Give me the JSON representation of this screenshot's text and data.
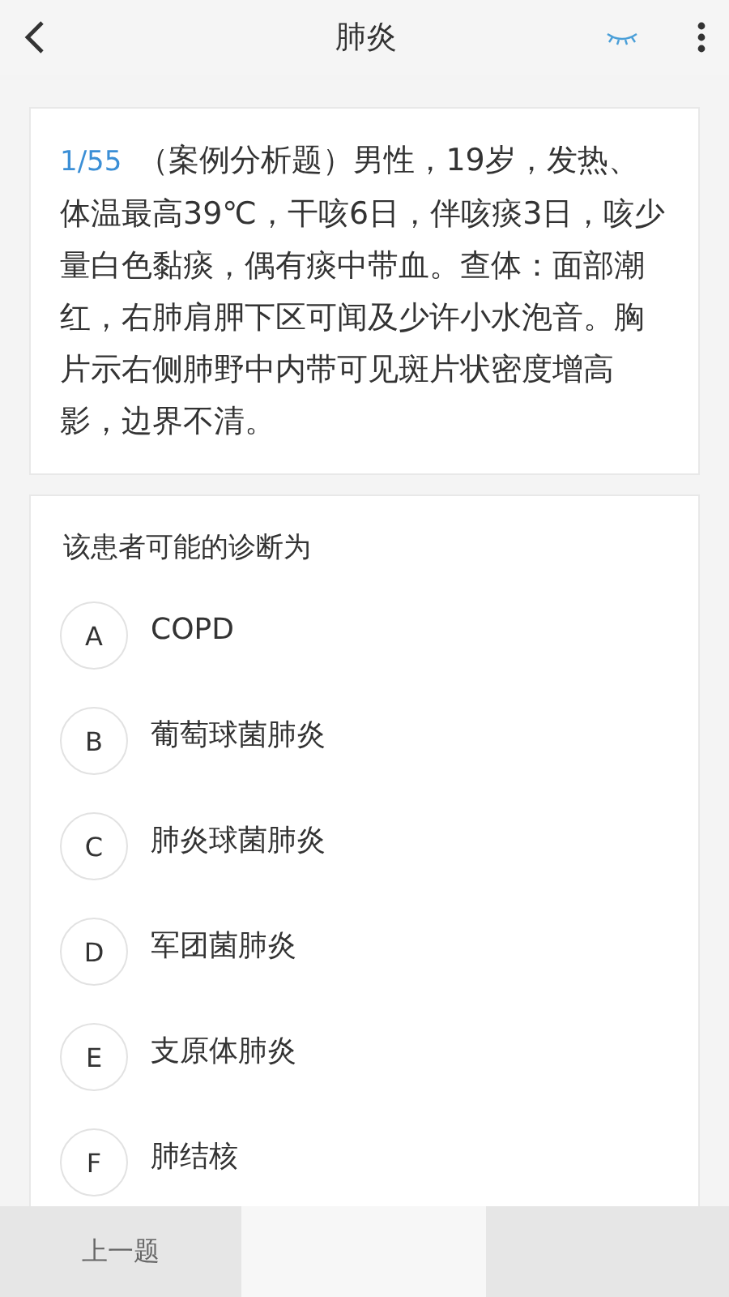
{
  "header": {
    "title": "肺炎"
  },
  "question": {
    "number": "1/55",
    "text": "（案例分析题）男性，19岁，发热、体温最高39℃，干咳6日，伴咳痰3日，咳少量白色黏痰，偶有痰中带血。查体：面部潮红，右肺肩胛下区可闻及少许小水泡音。胸片示右侧肺野中内带可见斑片状密度增高影，边界不清。"
  },
  "prompt": "该患者可能的诊断为",
  "options": [
    {
      "letter": "A",
      "text": "COPD",
      "selected": false
    },
    {
      "letter": "B",
      "text": "葡萄球菌肺炎",
      "selected": false
    },
    {
      "letter": "C",
      "text": "肺炎球菌肺炎",
      "selected": false
    },
    {
      "letter": "D",
      "text": "军团菌肺炎",
      "selected": false
    },
    {
      "letter": "E",
      "text": "支原体肺炎",
      "selected": false
    },
    {
      "letter": "F",
      "text": "肺结核",
      "selected": false
    }
  ],
  "bottom_bar": {
    "prev": "上一题"
  }
}
